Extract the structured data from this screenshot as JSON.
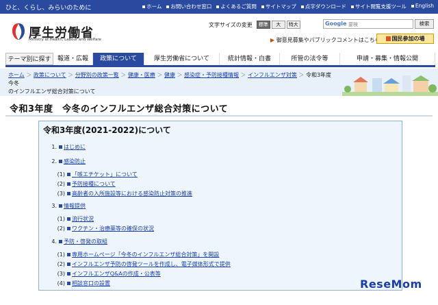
{
  "header": {
    "tagline": "ひと、くらし、みらいのために",
    "links": [
      "ホーム",
      "お問い合わせ窓口",
      "よくあるご質問",
      "サイトマップ",
      "点字ダウンロード",
      "サイト閲覧支援ツール",
      "English"
    ]
  },
  "logo": {
    "name_jp": "厚生労働省",
    "name_en": "Ministry of Health, Labour and Welfare",
    "brand_color": "#e0332d"
  },
  "font_size": {
    "label": "文字サイズの変更",
    "options": [
      "標準",
      "大",
      "特大"
    ],
    "selected": "標準"
  },
  "search": {
    "brand": "Google",
    "placeholder": "要検",
    "button": "検索"
  },
  "opinion_link": "御意見募集やパブリックコメントはこちら",
  "join_button": "国民参加の場",
  "nav": {
    "items": [
      "テーマ別に探す",
      "報道・広報",
      "政策について",
      "厚生労働省について",
      "統計情報・白書",
      "所管の法令等",
      "申請・募集・情報公開"
    ],
    "active": "政策について"
  },
  "breadcrumb": {
    "items": [
      "ホーム",
      "政策について",
      "分野別の政策一覧",
      "健康・医療",
      "健康",
      "感染症・予防接種情報",
      "インフルエンザ対策"
    ],
    "current_line1": "令和3年度　今冬",
    "current_line2": "のインフルエンザ総合対策について"
  },
  "page_title": "令和3年度　今冬のインフルエンザ総合対策について",
  "panel": {
    "title": "令和3年度(2021-2022)について",
    "sections": [
      {
        "num": "1.",
        "label": "はじめに",
        "subs": []
      },
      {
        "num": "2.",
        "label": "感染防止",
        "subs": [
          {
            "num": "(1)",
            "label": "「咳エチケット」について"
          },
          {
            "num": "(2)",
            "label": "予防接種について"
          },
          {
            "num": "(3)",
            "label": "高齢者の入所施設等における感染防止対策の推進"
          }
        ]
      },
      {
        "num": "3.",
        "label": "情報提供",
        "subs": [
          {
            "num": "(1)",
            "label": "流行状況"
          },
          {
            "num": "(2)",
            "label": "ワクチン・治療薬等の確保の状況"
          }
        ]
      },
      {
        "num": "4.",
        "label": "予防・啓発の取組",
        "subs": [
          {
            "num": "(1)",
            "label": "専用ホームページ「今冬のインフルエンザ総合対策」を開設"
          },
          {
            "num": "(2)",
            "label": "インフルエンザ予防の啓発ツールを作成し、電子媒体形式で提供"
          },
          {
            "num": "(3)",
            "label": "インフルエンザQ&Aの作成・公表等"
          },
          {
            "num": "(4)",
            "label": "相談窓口の設置"
          }
        ]
      }
    ]
  },
  "watermark": "ReseMom",
  "colors": {
    "accent": "#2a4aa0",
    "link": "#1a3fa8",
    "panel_bg": "#eef5fc"
  }
}
